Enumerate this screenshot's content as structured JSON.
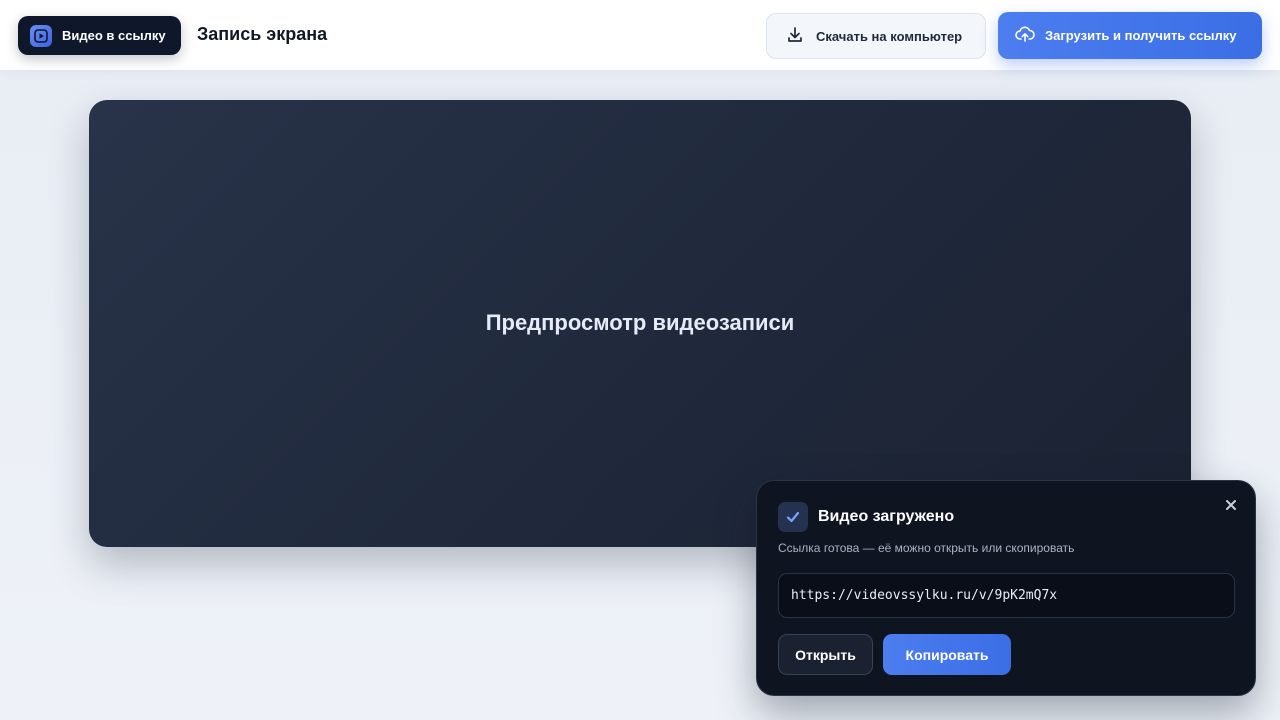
{
  "header": {
    "brand_label": "Видео в ссылку",
    "brand_icon": "play-icon",
    "page_title": "Запись экрана",
    "download_label": "Скачать на компьютер",
    "download_icon": "download-icon",
    "upload_label": "Загрузить и получить ссылку",
    "upload_icon": "cloud-upload-icon"
  },
  "preview": {
    "text": "Предпросмотр видеозаписи"
  },
  "toast": {
    "check_icon": "check-icon",
    "title": "Видео загружено",
    "subtitle": "Ссылка готова — её можно открыть или скопировать",
    "url": "https://videovssylku.ru/v/9pK2mQ7x",
    "close_icon": "close-icon",
    "open_label": "Открыть",
    "copy_label": "Копировать"
  },
  "colors": {
    "accent": "#3b6de5",
    "dark": "#0f172a",
    "toast_bg": "#0f1421"
  }
}
